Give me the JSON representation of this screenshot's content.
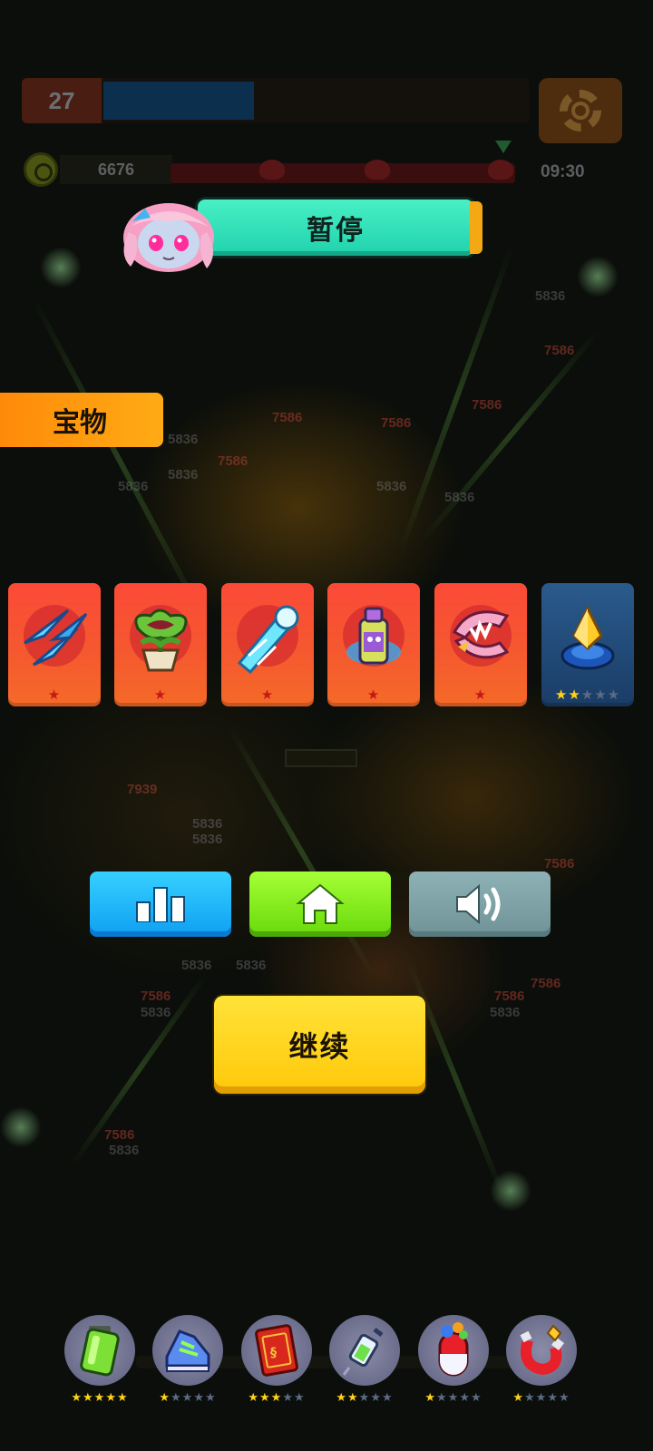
{
  "hud": {
    "level": "27",
    "xp_progress": 0.36,
    "coins": "6676",
    "timer": "09:30"
  },
  "pause_title": "暂停",
  "treasure_label": "宝物",
  "treasures": [
    {
      "icon": "blue-shuriken-blades-icon",
      "stars": 1,
      "max_stars": 1
    },
    {
      "icon": "piranha-plant-pot-icon",
      "stars": 1,
      "max_stars": 1
    },
    {
      "icon": "ice-lightning-arm-icon",
      "stars": 1,
      "max_stars": 1
    },
    {
      "icon": "spray-can-icon",
      "stars": 1,
      "max_stars": 1
    },
    {
      "icon": "chomper-jaw-icon",
      "stars": 1,
      "max_stars": 1
    },
    {
      "icon": "gold-crystal-pedestal-icon",
      "stars": 2,
      "max_stars": 5
    }
  ],
  "buttons": {
    "stats": "bar-chart-icon",
    "home": "home-icon",
    "sound": "speaker-icon"
  },
  "continue_label": "继续",
  "passives": [
    {
      "icon": "green-battery-icon",
      "stars": 5,
      "max_stars": 5
    },
    {
      "icon": "sneaker-icon",
      "stars": 1,
      "max_stars": 5
    },
    {
      "icon": "red-book-icon",
      "stars": 3,
      "max_stars": 5
    },
    {
      "icon": "syringe-icon",
      "stars": 2,
      "max_stars": 5
    },
    {
      "icon": "capsule-pill-icon",
      "stars": 1,
      "max_stars": 5
    },
    {
      "icon": "magnet-icon",
      "stars": 1,
      "max_stars": 5
    }
  ],
  "colors": {
    "pause_banner": "#2ee3bb",
    "treasure_tab": "#ff9a10",
    "card_red": "#f5502f",
    "card_blue": "#234c7a",
    "btn_blue": "#1ab4fa",
    "btn_green": "#86ea1e",
    "btn_gray": "#7fa3a7",
    "continue": "#ffd31e",
    "star_gold": "#ffd21a"
  }
}
